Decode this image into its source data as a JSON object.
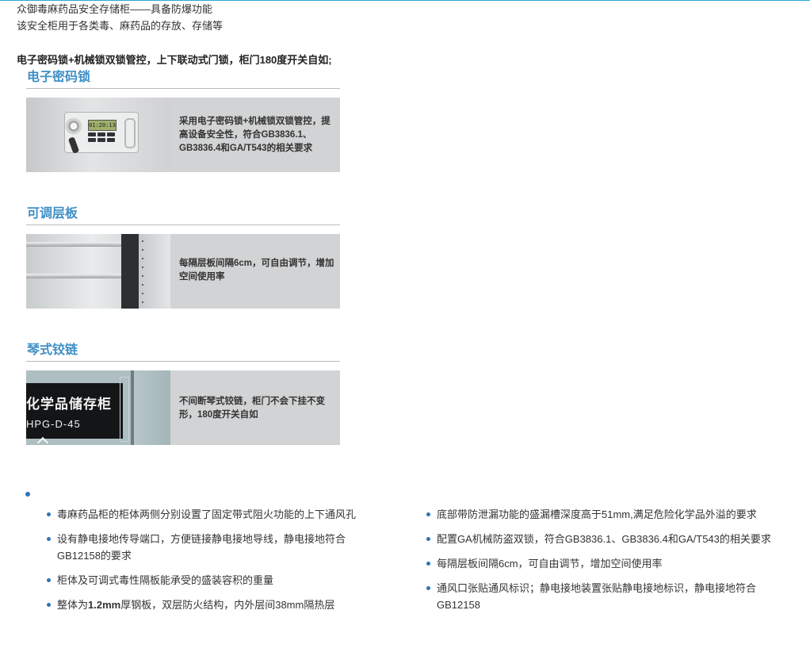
{
  "colors": {
    "accent_line": "#2aa8d8",
    "section_title": "#3f8fc6",
    "bullet": "#2f74b5"
  },
  "intro": {
    "line1": "众御毒麻药品安全存储柜——具备防爆功能",
    "line2": "该安全柜用于各类毒、麻药品的存放、存储等"
  },
  "headline": "电子密码锁+机械锁双锁管控，上下联动式门锁，柜门180度开关自如;",
  "features": [
    {
      "title": "电子密码锁",
      "text": "采用电子密码锁+机械锁双锁管控，提高设备安全性，符合GB3836.1、GB3836.4和GA/T543的相关要求",
      "image_screen": "01:20:13",
      "image_icon": "electronic-lock-photo"
    },
    {
      "title": "可调层板",
      "text": "每隔层板间隔6cm，可自由调节，增加空间使用率",
      "image_icon": "adjustable-shelf-photo"
    },
    {
      "title": "琴式铰链",
      "text": "不间断琴式铰链，柜门不会下挂不变形，180度开关自如",
      "image_label_1": "化学品储存柜",
      "image_label_2": "HPG-D-45",
      "image_icon": "piano-hinge-cabinet-photo"
    }
  ],
  "bullets_left": [
    "毒麻药品柜的柜体两侧分别设置了固定带式阻火功能的上下通风孔",
    "设有静电接地传导端口，方便链接静电接地导线，静电接地符合GB12158的要求",
    "柜体及可调式毒性隔板能承受的盛装容积的重量",
    {
      "before": "整体为",
      "bold": "1.2mm",
      "after": "厚钢板，双层防火结构，内外层间38mm隔热层"
    }
  ],
  "bullets_right": [
    "底部带防泄漏功能的盛漏槽深度高于51mm,满足危险化学品外溢的要求",
    "配置GA机械防盗双锁，符合GB3836.1、GB3836.4和GA/T543的相关要求",
    "每隔层板间隔6cm，可自由调节，增加空间使用率",
    "通风口张贴通风标识；静电接地装置张贴静电接地标识，静电接地符合GB12158"
  ]
}
